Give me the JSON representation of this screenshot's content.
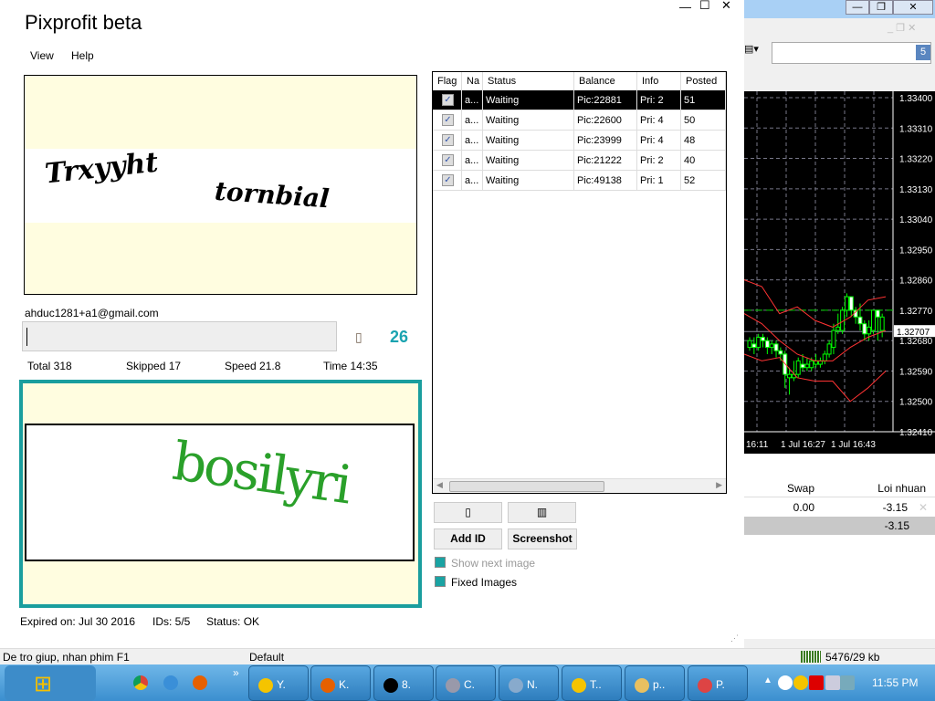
{
  "app": {
    "title": "Pixprofit beta",
    "menu": [
      "View",
      "Help"
    ],
    "window_controls": {
      "minimize": "—",
      "maximize": "☐",
      "close": "✕"
    }
  },
  "captcha_top": {
    "text1": "Trxyyht",
    "text2": "tornbial"
  },
  "account": {
    "email": "ahduc1281+a1@gmail.com",
    "input_value": "",
    "counter": "26",
    "icon": "▯"
  },
  "stats": {
    "total": "Total 318",
    "skipped": "Skipped 17",
    "speed": "Speed 21.8",
    "time": "Time 14:35"
  },
  "captcha_bottom": {
    "text": "bosilyri",
    "accent": "#1a9e9e",
    "text_color": "#2aa02a"
  },
  "footer": {
    "expired": "Expired on: Jul 30 2016",
    "ids": "IDs: 5/5",
    "status": "Status: OK"
  },
  "grid": {
    "columns": [
      "Flag",
      "Na",
      "Status",
      "Balance",
      "Info",
      "Posted"
    ],
    "rows": [
      {
        "name": "a...",
        "status": "Waiting",
        "balance": "Pic:22881",
        "info": "Pri: 2",
        "posted": "51",
        "checked": true,
        "selected": true
      },
      {
        "name": "a...",
        "status": "Waiting",
        "balance": "Pic:22600",
        "info": "Pri: 4",
        "posted": "50",
        "checked": true
      },
      {
        "name": "a...",
        "status": "Waiting",
        "balance": "Pic:23999",
        "info": "Pri: 4",
        "posted": "48",
        "checked": true
      },
      {
        "name": "a...",
        "status": "Waiting",
        "balance": "Pic:21222",
        "info": "Pri: 2",
        "posted": "40",
        "checked": true
      },
      {
        "name": "a...",
        "status": "Waiting",
        "balance": "Pic:49138",
        "info": "Pri: 1",
        "posted": "52",
        "checked": true
      }
    ]
  },
  "buttons": {
    "b1": "▯",
    "b2": "▥",
    "add_id": "Add ID",
    "screenshot": "Screenshot"
  },
  "options": {
    "show_next": "Show next image",
    "fixed_images": "Fixed Images"
  },
  "mt4": {
    "badge": "5",
    "prices": [
      "1.33400",
      "1.33310",
      "1.33220",
      "1.33130",
      "1.33040",
      "1.32950",
      "1.32860",
      "1.32770",
      "1.32680",
      "1.32590",
      "1.32500",
      "1.32410"
    ],
    "current_price": "1.32707",
    "times": [
      "16:11",
      "1 Jul 16:27",
      "1 Jul 16:43"
    ],
    "table": {
      "swap_header": "Swap",
      "profit_header": "Loi nhuan",
      "swap": "0.00",
      "profit": "-3.15",
      "total": "-3.15"
    },
    "candles": [
      [
        1.3266,
        1.3268,
        1.3265,
        1.3269
      ],
      [
        1.3267,
        1.3266,
        1.3264,
        1.3269
      ],
      [
        1.3266,
        1.3269,
        1.3265,
        1.327
      ],
      [
        1.3269,
        1.3268,
        1.3266,
        1.327
      ],
      [
        1.3268,
        1.3266,
        1.3264,
        1.3269
      ],
      [
        1.3266,
        1.3267,
        1.3264,
        1.3268
      ],
      [
        1.3267,
        1.3265,
        1.3263,
        1.3268
      ],
      [
        1.3265,
        1.3264,
        1.3262,
        1.3266
      ],
      [
        1.3264,
        1.3258,
        1.3254,
        1.3265
      ],
      [
        1.3257,
        1.3258,
        1.3252,
        1.326
      ],
      [
        1.3257,
        1.3258,
        1.3256,
        1.3262
      ],
      [
        1.3258,
        1.3262,
        1.3257,
        1.3263
      ],
      [
        1.3261,
        1.326,
        1.3259,
        1.3264
      ],
      [
        1.326,
        1.3261,
        1.3259,
        1.3263
      ],
      [
        1.326,
        1.3262,
        1.3259,
        1.3263
      ],
      [
        1.3261,
        1.3262,
        1.326,
        1.3264
      ],
      [
        1.3261,
        1.3262,
        1.326,
        1.3263
      ],
      [
        1.3262,
        1.3264,
        1.3261,
        1.3265
      ],
      [
        1.3264,
        1.3267,
        1.3263,
        1.3268
      ],
      [
        1.3266,
        1.3271,
        1.3264,
        1.3273
      ],
      [
        1.3271,
        1.3272,
        1.327,
        1.3276
      ],
      [
        1.3271,
        1.3277,
        1.327,
        1.3278
      ],
      [
        1.3277,
        1.3281,
        1.3275,
        1.3282
      ],
      [
        1.3281,
        1.3277,
        1.3275,
        1.3281
      ],
      [
        1.3277,
        1.3275,
        1.3273,
        1.3278
      ],
      [
        1.3275,
        1.3273,
        1.3271,
        1.3279
      ],
      [
        1.3273,
        1.327,
        1.3268,
        1.3274
      ],
      [
        1.327,
        1.3272,
        1.3268,
        1.3274
      ],
      [
        1.3271,
        1.3277,
        1.327,
        1.3277
      ],
      [
        1.3277,
        1.3275,
        1.3268,
        1.3277
      ],
      [
        1.3271,
        1.3275,
        1.3269,
        1.3276
      ]
    ]
  },
  "statusbar": {
    "help": "De tro giup, nhan phim F1",
    "profile": "Default",
    "traffic": "5476/29 kb"
  },
  "taskbar": {
    "items": [
      "Y.",
      "K.",
      "8.",
      "C.",
      "N.",
      "T..",
      "p..",
      "P."
    ],
    "clock": "11:55 PM",
    "chevron": "»"
  }
}
